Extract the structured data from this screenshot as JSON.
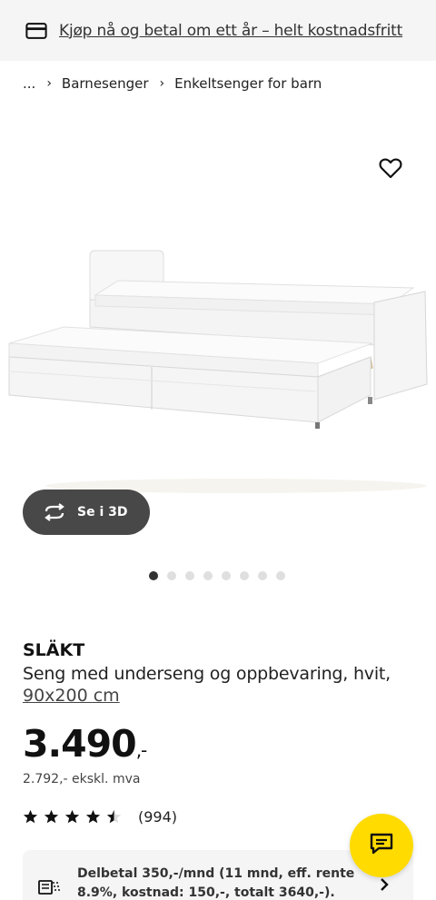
{
  "promo": {
    "icon": "credit-card-icon",
    "text": "Kjøp nå og betal om ett år – helt kostnadsfritt"
  },
  "breadcrumb": {
    "items": [
      "...",
      "Barnesenger",
      "Enkeltsenger for barn"
    ]
  },
  "gallery": {
    "favorite_icon": "heart-icon",
    "view_3d_label": "Se i 3D",
    "view_3d_icon": "rotate-icon",
    "dots_total": 8,
    "active_dot": 1
  },
  "product": {
    "name": "SLÄKT",
    "description": "Seng med underseng og oppbevaring, hvit,",
    "size": "90x200 cm",
    "price": "3.490",
    "price_suffix": ",-",
    "price_ex_vat": "2.792,- ekskl. mva",
    "rating": 4.5,
    "rating_max": 5,
    "review_count": "(994)"
  },
  "finance": {
    "icon": "installment-icon",
    "text": "Delbetal 350,-/mnd (11 mnd, eff. rente 8.9%, kostnad: 150,-, totalt 3640,-)."
  },
  "chat": {
    "icon": "chat-icon"
  },
  "colors": {
    "accent_yellow": "#ffdb00",
    "button_dark": "#484848"
  }
}
